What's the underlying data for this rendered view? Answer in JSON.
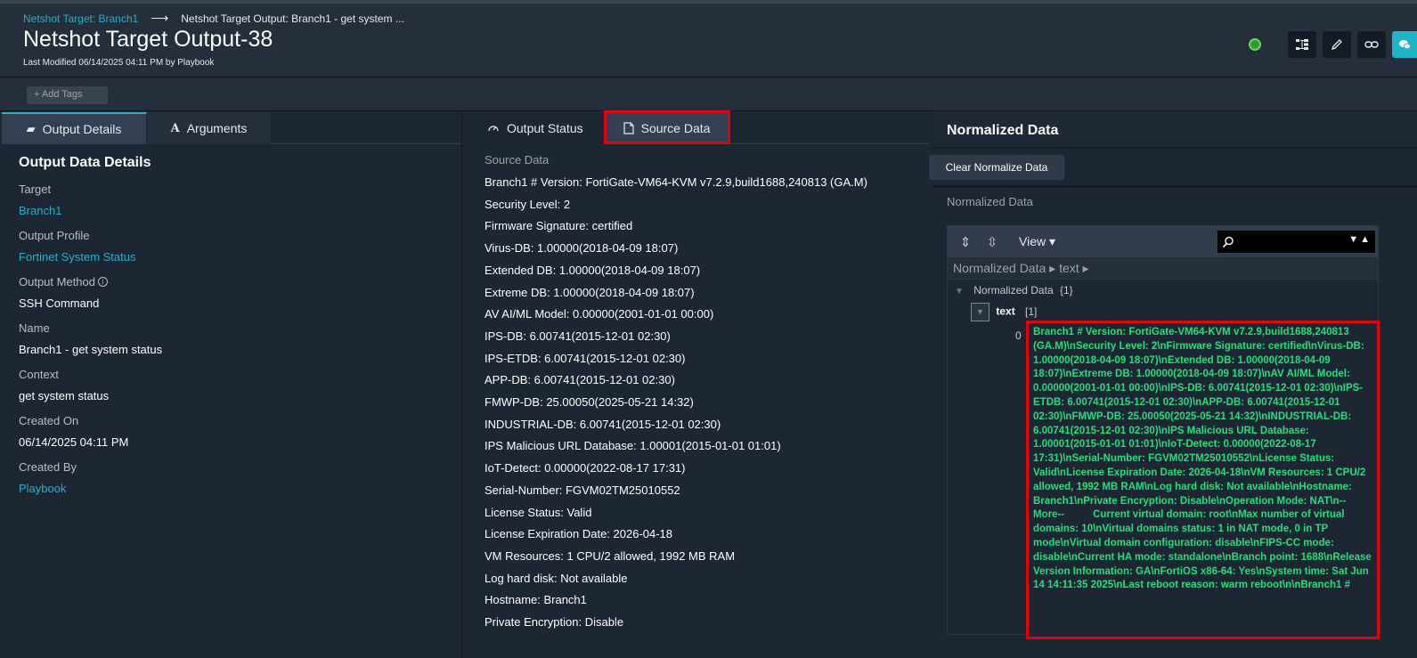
{
  "header": {
    "breadcrumb_parent": "Netshot Target: Branch1",
    "breadcrumb_arrow": "⟶",
    "breadcrumb_current": "Netshot Target Output: Branch1 - get system ...",
    "title": "Netshot Target Output-38",
    "modified": "Last Modified 06/14/2025 04:11 PM by Playbook"
  },
  "tags": {
    "add_label": "+ Add Tags"
  },
  "left_panel": {
    "tabs": [
      {
        "label": "Output Details",
        "icon": "book-icon"
      },
      {
        "label": "Arguments",
        "icon": "letter-a-icon"
      }
    ],
    "section_title": "Output Data Details",
    "fields": [
      {
        "label": "Target",
        "value": "Branch1"
      },
      {
        "label": "Output Profile",
        "value": "Fortinet System Status"
      },
      {
        "label": "Output Method",
        "value": "SSH Command"
      },
      {
        "label": "Name",
        "value": "Branch1 - get system status"
      },
      {
        "label": "Context",
        "value": "get system status"
      },
      {
        "label": "Created On",
        "value": "06/14/2025 04:11 PM"
      },
      {
        "label": "Created By",
        "value": "Playbook"
      }
    ]
  },
  "middle_panel": {
    "tabs": [
      {
        "label": "Output Status",
        "icon": "gauge-icon"
      },
      {
        "label": "Source Data",
        "icon": "document-icon"
      }
    ],
    "source_label": "Source Data",
    "lines": [
      "Branch1 # Version: FortiGate-VM64-KVM v7.2.9,build1688,240813 (GA.M)",
      "Security Level: 2",
      "Firmware Signature: certified",
      "Virus-DB: 1.00000(2018-04-09 18:07)",
      "Extended DB: 1.00000(2018-04-09 18:07)",
      "Extreme DB: 1.00000(2018-04-09 18:07)",
      "AV AI/ML Model: 0.00000(2001-01-01 00:00)",
      "IPS-DB: 6.00741(2015-12-01 02:30)",
      "IPS-ETDB: 6.00741(2015-12-01 02:30)",
      "APP-DB: 6.00741(2015-12-01 02:30)",
      "FMWP-DB: 25.00050(2025-05-21 14:32)",
      "INDUSTRIAL-DB: 6.00741(2015-12-01 02:30)",
      "IPS Malicious URL Database: 1.00001(2015-01-01 01:01)",
      "IoT-Detect: 0.00000(2022-08-17 17:31)",
      "Serial-Number: FGVM02TM25010552",
      "License Status: Valid",
      "License Expiration Date: 2026-04-18",
      "VM Resources: 1 CPU/2 allowed, 1992 MB RAM",
      "Log hard disk: Not available",
      "Hostname: Branch1",
      "Private Encryption: Disable"
    ]
  },
  "right_panel": {
    "title": "Normalized Data",
    "clear_button": "Clear Normalize Data",
    "label": "Normalized Data",
    "viewer": {
      "view_label": "View ▾",
      "search_value": "",
      "path": "Normalized Data ▸ text ▸",
      "root_key": "Normalized Data",
      "root_count": "{1}",
      "child_key": "text",
      "child_count": "[1]",
      "index": "0",
      "value": "Branch1 # Version: FortiGate-VM64-KVM v7.2.9,build1688,240813 (GA.M)\\nSecurity Level: 2\\nFirmware Signature: certified\\nVirus-DB: 1.00000(2018-04-09 18:07)\\nExtended DB: 1.00000(2018-04-09 18:07)\\nExtreme DB: 1.00000(2018-04-09 18:07)\\nAV AI/ML Model: 0.00000(2001-01-01 00:00)\\nIPS-DB: 6.00741(2015-12-01 02:30)\\nIPS-ETDB: 6.00741(2015-12-01 02:30)\\nAPP-DB: 6.00741(2015-12-01 02:30)\\nFMWP-DB: 25.00050(2025-05-21 14:32)\\nINDUSTRIAL-DB: 6.00741(2015-12-01 02:30)\\nIPS Malicious URL Database: 1.00001(2015-01-01 01:01)\\nIoT-Detect: 0.00000(2022-08-17 17:31)\\nSerial-Number: FGVM02TM25010552\\nLicense Status: Valid\\nLicense Expiration Date: 2026-04-18\\nVM Resources: 1 CPU/2 allowed, 1992 MB RAM\\nLog hard disk: Not available\\nHostname: Branch1\\nPrivate Encryption: Disable\\nOperation Mode: NAT\\n--More--          Current virtual domain: root\\nMax number of virtual domains: 10\\nVirtual domains status: 1 in NAT mode, 0 in TP mode\\nVirtual domain configuration: disable\\nFIPS-CC mode: disable\\nCurrent HA mode: standalone\\nBranch point: 1688\\nRelease Version Information: GA\\nFortiOS x86-64: Yes\\nSystem time: Sat Jun 14 14:11:35 2025\\nLast reboot reason: warm reboot\\n\\nBranch1 #"
    }
  },
  "colors": {
    "accent": "#27b0c6",
    "highlight": "#e3000f",
    "json_value": "#1ee07a",
    "status_ok": "#2f9e2f"
  }
}
